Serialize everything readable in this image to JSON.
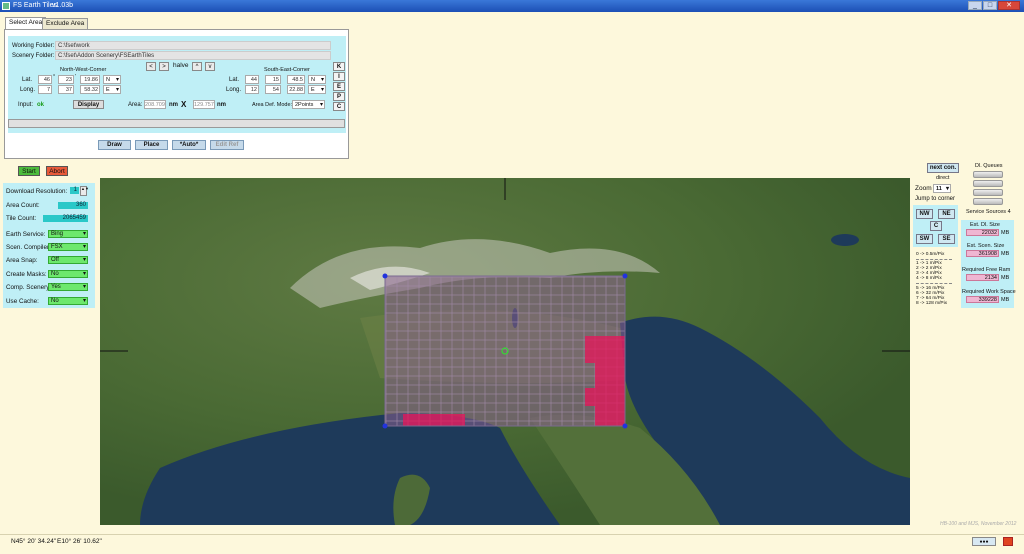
{
  "window": {
    "title": "FS Earth Tiles",
    "version": "v1.03b",
    "controls": [
      "_",
      "□",
      "✕"
    ]
  },
  "tabs": [
    {
      "label": "Select Area",
      "active": true
    },
    {
      "label": "Exclude Area",
      "active": false
    }
  ],
  "folders": {
    "working_label": "Working Folder:",
    "working_value": "C:\\fset\\work",
    "scenery_label": "Scenery Folder:",
    "scenery_value": "C:\\fset\\Addon Scenery\\FSEarthTiles"
  },
  "nav": {
    "left": "<",
    "right": ">",
    "halve": "halve",
    "up": "^",
    "down": "v"
  },
  "side_buttons": [
    "K",
    "I",
    "E",
    "P",
    "C"
  ],
  "nw_corner": {
    "title": "North-West-Corner",
    "lat_label": "Lat.",
    "long_label": "Long.",
    "lat_deg": "46",
    "lat_min": "23",
    "lat_sec": "19.86",
    "lat_hemi": "N",
    "lon_deg": "7",
    "lon_min": "37",
    "lon_sec": "58.32",
    "lon_hemi": "E"
  },
  "se_corner": {
    "title": "South-East-Corner",
    "lat_label": "Lat.",
    "long_label": "Long.",
    "lat_deg": "44",
    "lat_min": "15",
    "lat_sec": "48.5",
    "lat_hemi": "N",
    "lon_deg": "12",
    "lon_min": "54",
    "lon_sec": "22.88",
    "lon_hemi": "E"
  },
  "units": {
    "deg": "°",
    "min": "'",
    "sec": "\""
  },
  "input": {
    "label": "Input:",
    "value": "ok"
  },
  "display_button": "Display",
  "area": {
    "label": "Area:",
    "width": "208.709",
    "unit1": "nm",
    "x": "X",
    "height": "129.757",
    "unit2": "nm",
    "mode_label": "Area Def. Mode:",
    "mode_value": "2Points"
  },
  "action_buttons": [
    "Draw",
    "Place",
    "*Auto*",
    "Edit Ref"
  ],
  "start_button": "Start",
  "abort_button": "Abort",
  "settings": {
    "download_resolution_label": "Download Resolution:",
    "download_resolution_value": "1",
    "area_count_label": "Area Count:",
    "area_count_value": "360",
    "tile_count_label": "Tile Count:",
    "tile_count_value": "2065459",
    "rows": [
      {
        "label": "Earth Service:",
        "value": "Bing"
      },
      {
        "label": "Scen. Compiler:",
        "value": "FSX"
      },
      {
        "label": "Area Snap:",
        "value": "Off"
      },
      {
        "label": "Create Masks:",
        "value": "No"
      },
      {
        "label": "Comp. Scenery:",
        "value": "Yes"
      },
      {
        "label": "Use Cache:",
        "value": "No"
      }
    ]
  },
  "right": {
    "next_con": "next con.",
    "direct": "direct",
    "zoom_label": "Zoom",
    "zoom_value": "11",
    "jump_label": "Jump to corner",
    "corners": {
      "nw": "NW",
      "ne": "NE",
      "c": "C",
      "sw": "SW",
      "se": "SE"
    },
    "scale_lines": [
      "0 -> 0.5m/Pix",
      "1 -> 1 m/Pix",
      "2 -> 2 m/Pix",
      "3 -> 4 m/Pix",
      "4 -> 8 m/Pix",
      "5 -> 16 m/Pix",
      "6 -> 32 m/Pix",
      "7 -> 64 m/Pix",
      "8 -> 128 m/Pix"
    ],
    "queues_label": "Dl. Queues",
    "service_sources": "Service Sources 4",
    "est_dl_label": "Est. Dl. Size",
    "est_dl_value": "22032",
    "est_scen_label": "Est. Scen. Size",
    "est_scen_value": "361908",
    "ram_label": "Required Free Ram",
    "ram_value": "2134",
    "work_label": "Required Work Space",
    "work_value": "339228",
    "mb": "MB"
  },
  "credit": "HB-100 and MJS, November 2012",
  "status": {
    "lat": "N45° 20' 34.24\"",
    "lon": "E10° 26' 10.62\"",
    "dots": "●●●"
  },
  "colors": {
    "cyan_panel": "#bfeff6",
    "green": "#6de86d",
    "selection_border": "#2233dd",
    "tile_fill": "#8a6090",
    "downloaded_fill": "#e8145a"
  }
}
